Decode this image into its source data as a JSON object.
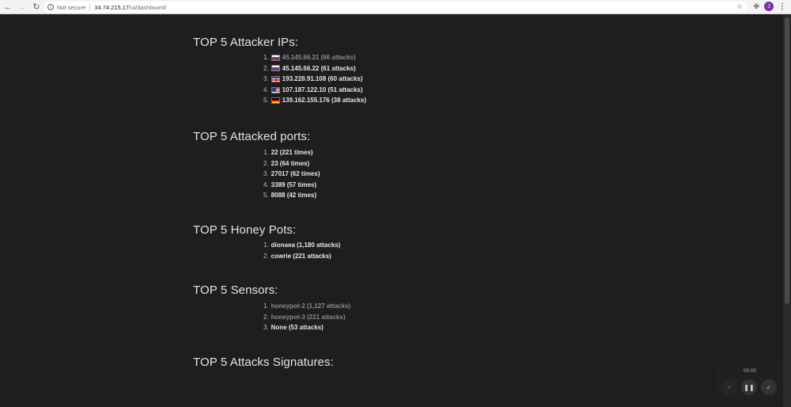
{
  "browser": {
    "security_label": "Not secure",
    "url_host": "34.74.215.17",
    "url_path": "/ui/dashboard/",
    "avatar_letter": "J"
  },
  "sections": {
    "attacker_ips": {
      "title": "TOP 5 Attacker IPs:",
      "items": [
        {
          "num": "1.",
          "flag": "ru",
          "text": "45.145.66.21 (66 attacks)",
          "dim": true
        },
        {
          "num": "2.",
          "flag": "ru",
          "text": "45.145.66.22 (61 attacks)",
          "dim": false
        },
        {
          "num": "3.",
          "flag": "gb",
          "text": "193.228.91.108 (60 attacks)",
          "dim": false
        },
        {
          "num": "4.",
          "flag": "us",
          "text": "107.187.122.10 (51 attacks)",
          "dim": false
        },
        {
          "num": "5.",
          "flag": "de",
          "text": "139.162.155.176 (38 attacks)",
          "dim": false
        }
      ]
    },
    "attacked_ports": {
      "title": "TOP 5 Attacked ports:",
      "items": [
        {
          "num": "1.",
          "text": "22 (221 times)"
        },
        {
          "num": "2.",
          "text": "23 (64 times)"
        },
        {
          "num": "3.",
          "text": "27017 (62 times)"
        },
        {
          "num": "4.",
          "text": "3389 (57 times)"
        },
        {
          "num": "5.",
          "text": "8088 (42 times)"
        }
      ]
    },
    "honey_pots": {
      "title": "TOP 5 Honey Pots:",
      "items": [
        {
          "num": "1.",
          "text": "dionaea (1,180 attacks)"
        },
        {
          "num": "2.",
          "text": "cowrie (221 attacks)"
        }
      ]
    },
    "sensors": {
      "title": "TOP 5 Sensors:",
      "items": [
        {
          "num": "1.",
          "text": "honeypot-2 (1,127 attacks)",
          "dim": true
        },
        {
          "num": "2.",
          "text": "honeypot-3 (221 attacks)",
          "dim": true
        },
        {
          "num": "3.",
          "text": "None (53 attacks)",
          "dim": false
        }
      ]
    },
    "signatures": {
      "title": "TOP 5 Attacks Signatures:"
    }
  },
  "recorder": {
    "time": "00:00"
  }
}
